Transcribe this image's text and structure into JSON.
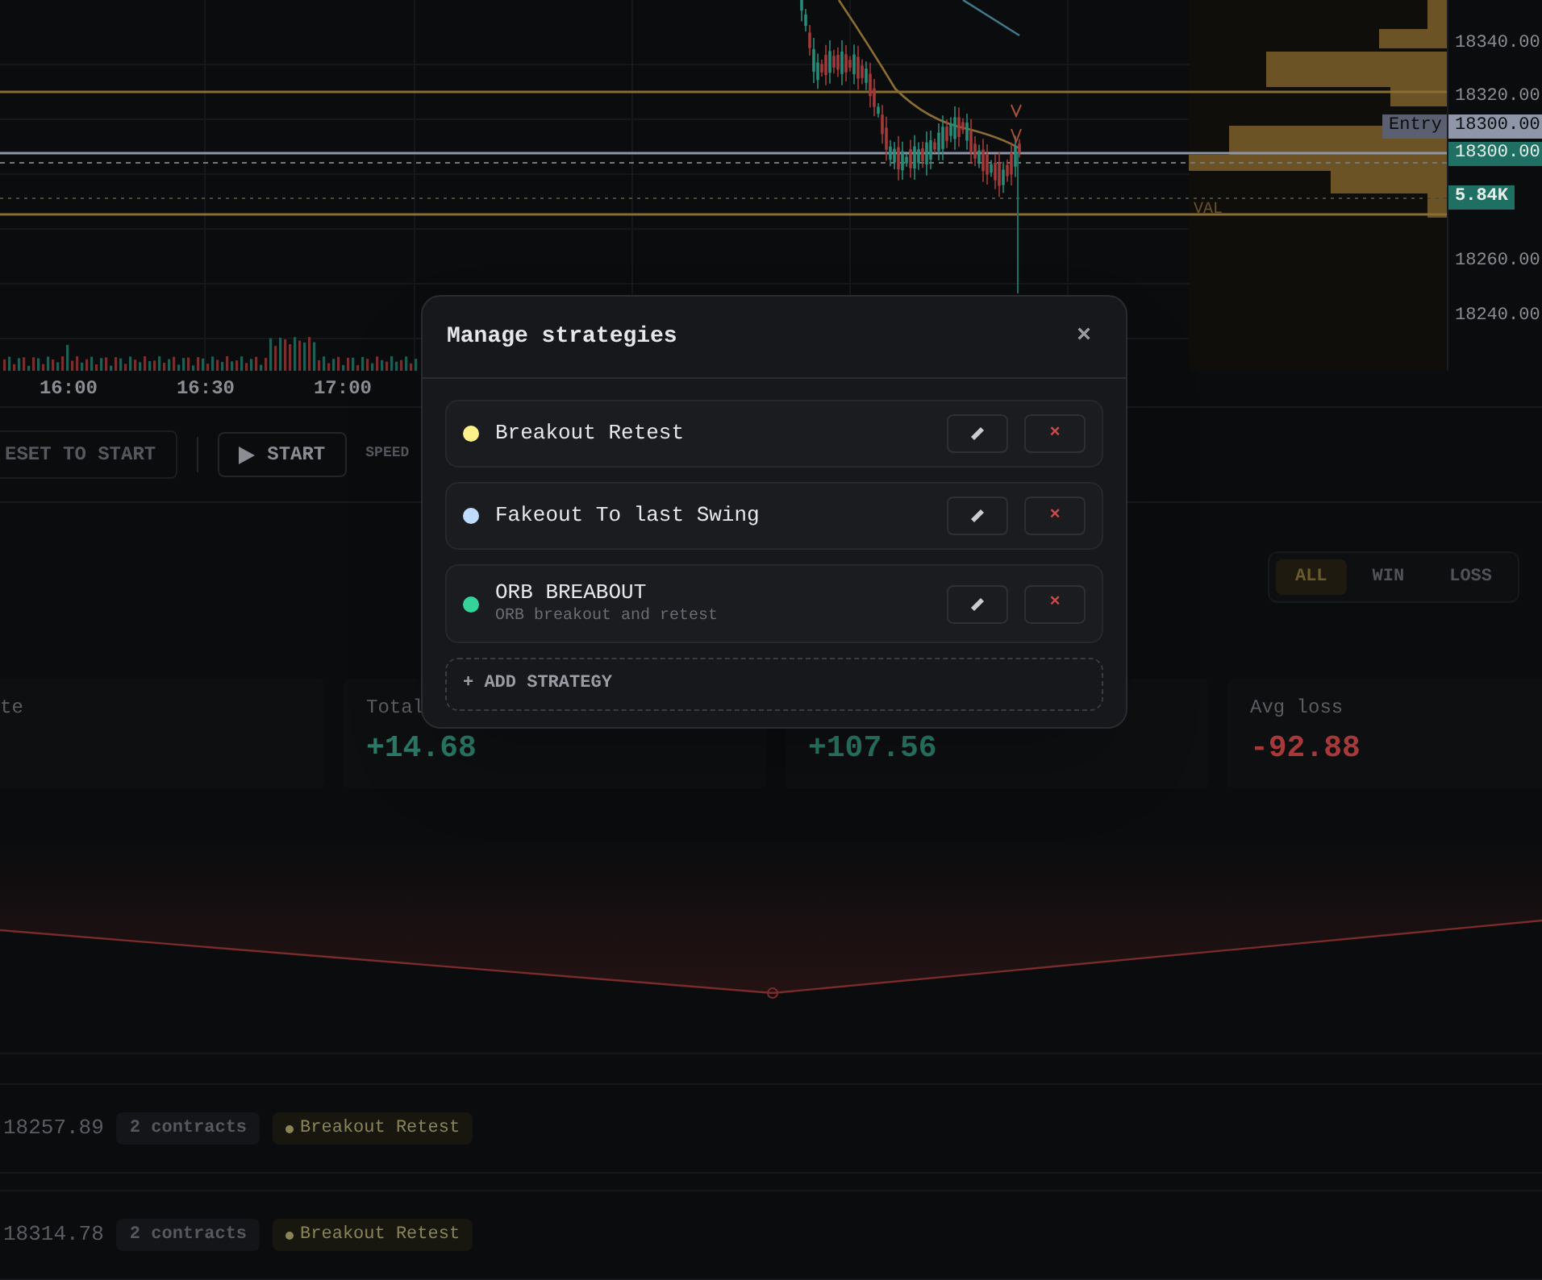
{
  "price_chart": {
    "price_labels": [
      {
        "text": "18340.00",
        "kind": "tick"
      },
      {
        "text": "18320.00",
        "kind": "tick"
      },
      {
        "text": "18300.00",
        "kind": "entry"
      },
      {
        "text": "18300.00",
        "kind": "last"
      },
      {
        "text": "5.84K",
        "kind": "volume"
      },
      {
        "text": "18260.00",
        "kind": "tick"
      },
      {
        "text": "18240.00",
        "kind": "tick"
      }
    ],
    "entry_tag": "Entry",
    "val_label": "VAL",
    "time_labels": [
      "16:00",
      "16:30",
      "17:00"
    ]
  },
  "playback": {
    "reset_button": {
      "label": "ESET TO START",
      "disabled": true
    },
    "start_button": {
      "label": "START",
      "disabled": false
    },
    "speed_label": "SPEED"
  },
  "filter_tabs": [
    {
      "label": "ALL",
      "selected": true
    },
    {
      "label": "WIN",
      "selected": false
    },
    {
      "label": "LOSS",
      "selected": false
    }
  ],
  "stats": [
    {
      "label": "te"
    },
    {
      "label": "Total",
      "value": "+14.68",
      "kind": "positive"
    },
    {
      "value": "+107.56",
      "kind": "positive"
    },
    {
      "label": "Avg loss",
      "value": "-92.88",
      "kind": "negative"
    }
  ],
  "trades": [
    {
      "price": "18257.89",
      "contracts": "2 contracts",
      "strategy": "Breakout Retest",
      "color": "#8a8456"
    },
    {
      "price": "18314.78",
      "contracts": "2 contracts",
      "strategy": "Breakout Retest",
      "color": "#8a8456"
    }
  ],
  "modal": {
    "title": "Manage strategies",
    "close": "×",
    "delete_glyph": "×",
    "add_button": "+ ADD STRATEGY",
    "strategies": [
      {
        "name": "Breakout Retest",
        "color": "#fef08a"
      },
      {
        "name": "Fakeout To last Swing",
        "color": "#bfdbfe"
      },
      {
        "name": "ORB BREABOUT",
        "description": "ORB breakout and retest",
        "color": "#34d399"
      }
    ]
  }
}
